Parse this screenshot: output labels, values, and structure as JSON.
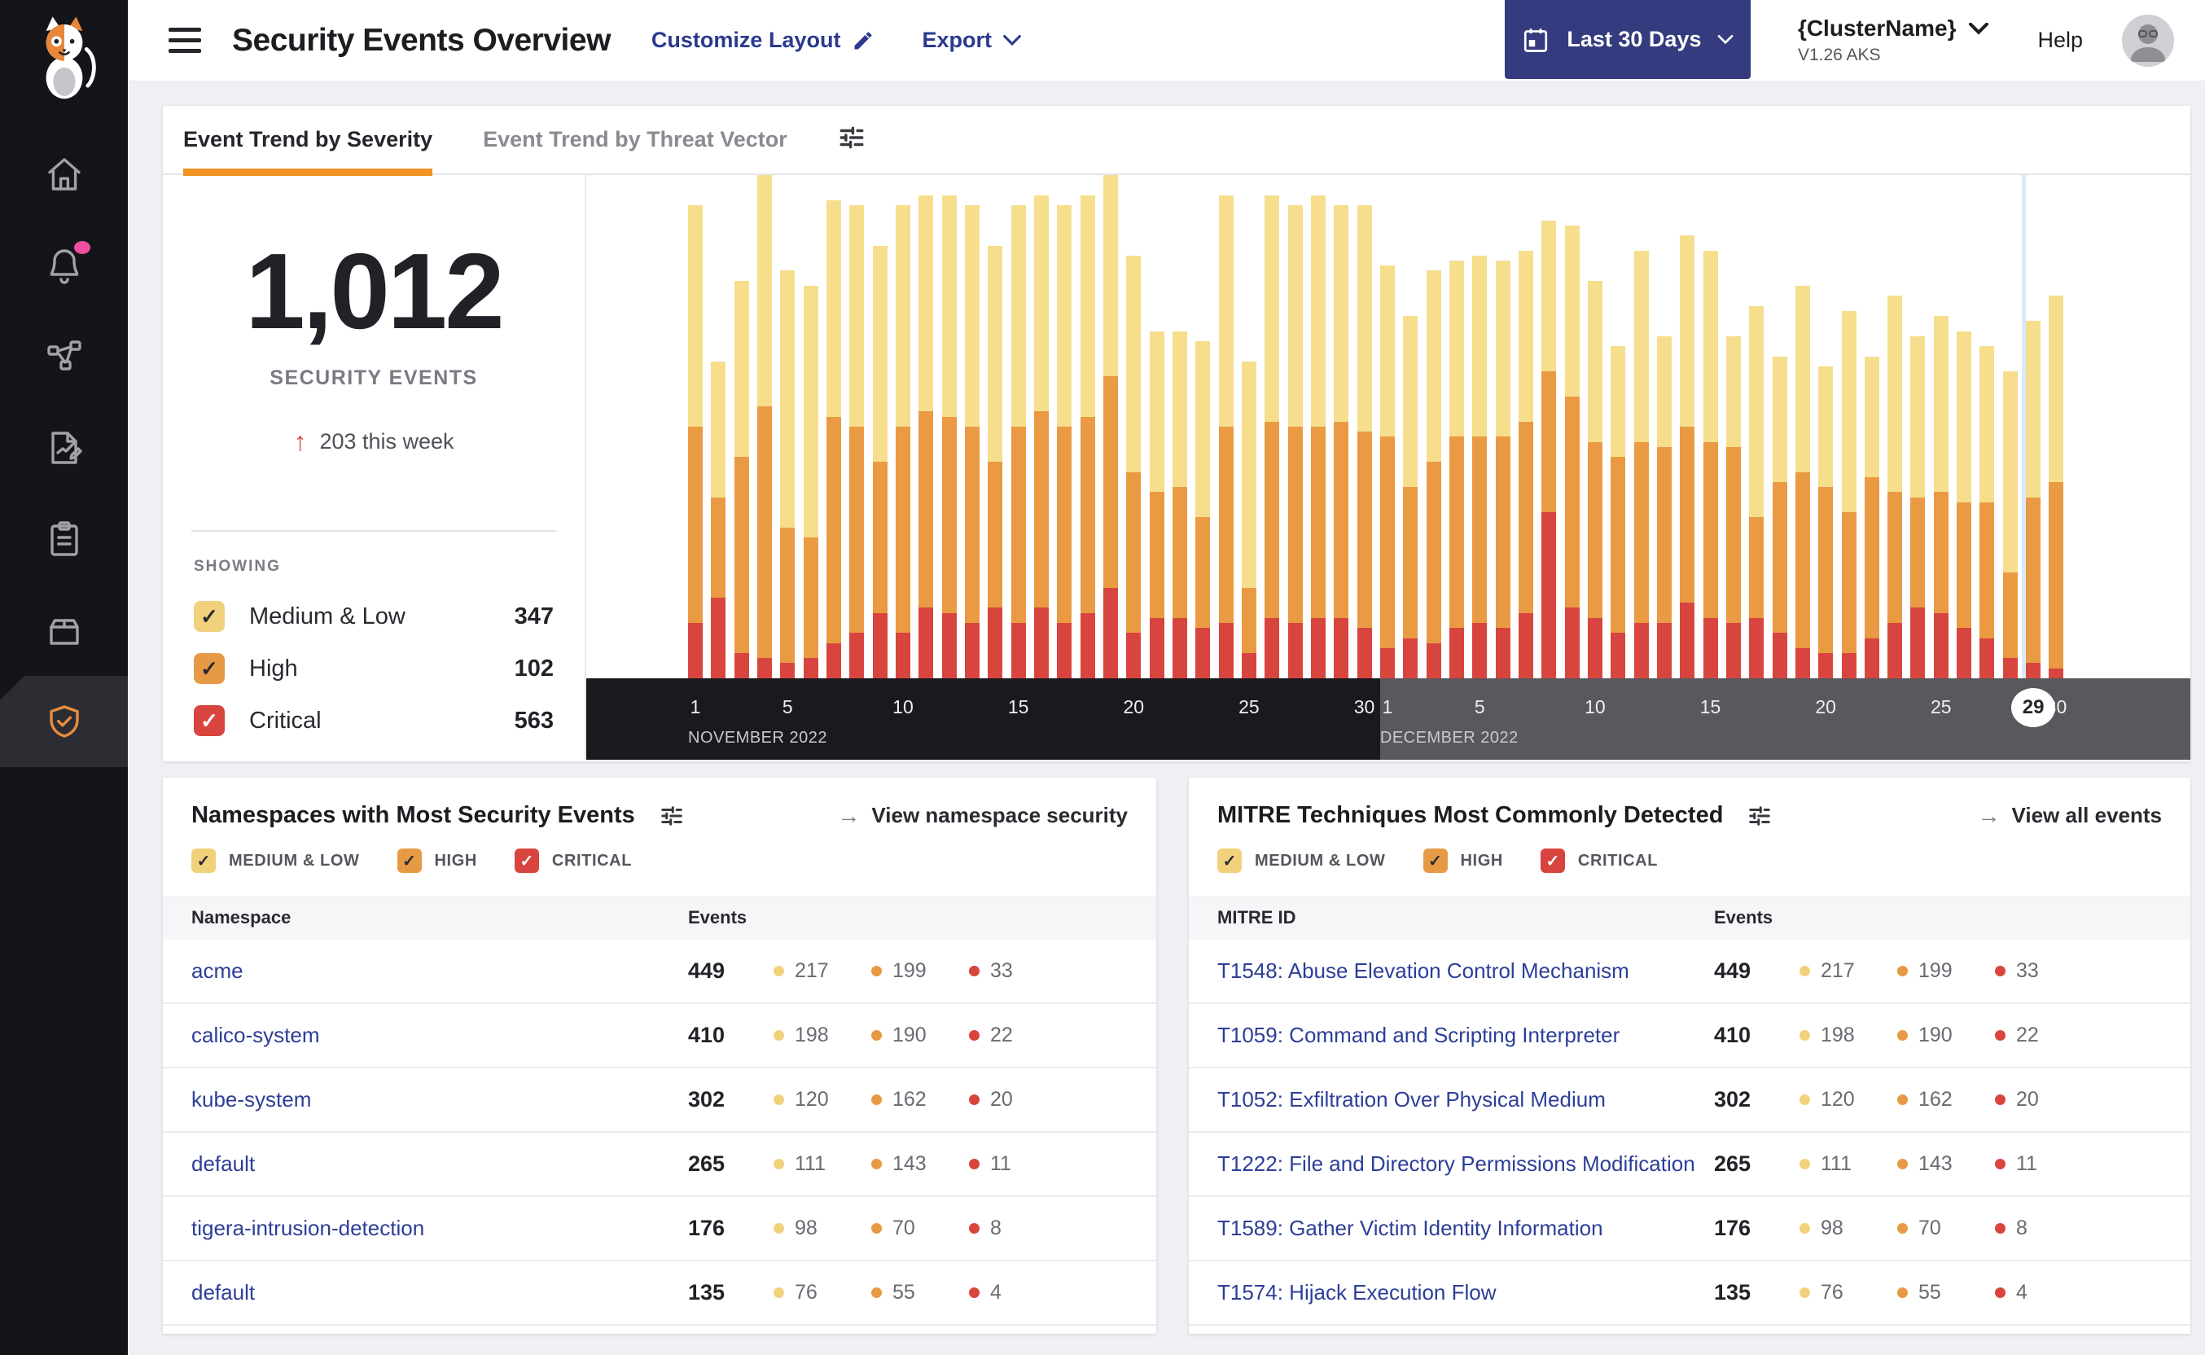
{
  "app": {
    "page_title": "Security Events Overview",
    "customize_label": "Customize Layout",
    "export_label": "Export",
    "date_range_button": "Last 30 Days",
    "cluster": {
      "name": "{ClusterName}",
      "version": "V1.26 AKS"
    },
    "help_label": "Help",
    "colors": {
      "accent_orange": "#f29423",
      "navy_button": "#343b7e",
      "link_navy": "#2b3a8f",
      "table_link_blue": "#2c3e97",
      "severity": {
        "medium_low": "#f2d17c",
        "high": "#e79a45",
        "critical": "#d8453e"
      },
      "bar": {
        "medium_low": "#f6de8d",
        "high": "#ea9a43",
        "critical": "#d8453e"
      }
    }
  },
  "sidebar": {
    "items": [
      {
        "name": "home",
        "active": false
      },
      {
        "name": "alerts",
        "active": false,
        "badge": true
      },
      {
        "name": "service-graph",
        "active": false
      },
      {
        "name": "reports",
        "active": false
      },
      {
        "name": "compliance",
        "active": false
      },
      {
        "name": "inventory",
        "active": false
      },
      {
        "name": "threat-defense",
        "active": true
      }
    ]
  },
  "tabs": [
    {
      "label": "Event Trend by Severity",
      "active": true
    },
    {
      "label": "Event Trend by Threat Vector",
      "active": false
    }
  ],
  "summary": {
    "total": "1,012",
    "caption": "SECURITY EVENTS",
    "trend_arrow": "↑",
    "trend_text": "203 this week",
    "showing_label": "SHOWING",
    "filters": [
      {
        "label": "Medium & Low",
        "count": "347",
        "severity": "medium_low",
        "checked": true
      },
      {
        "label": "High",
        "count": "102",
        "severity": "high",
        "checked": true
      },
      {
        "label": "Critical",
        "count": "563",
        "severity": "critical",
        "checked": true
      }
    ]
  },
  "chart_data": {
    "type": "bar",
    "stacked": true,
    "title": "Event Trend by Severity",
    "start_date": "Nov 1, 2022",
    "end_date": "Dec 30, 2022",
    "num_days": 60,
    "y_axis_visible": false,
    "unit": "percent of plot height (no y-axis labels shown)",
    "x_axis": {
      "months": [
        {
          "label": "NOVEMBER 2022",
          "ticks": [
            1,
            5,
            10,
            15,
            20,
            25,
            30
          ]
        },
        {
          "label": "DECEMBER 2022",
          "ticks": [
            1,
            5,
            10,
            15,
            20,
            25,
            30
          ]
        }
      ]
    },
    "current_day_marker": {
      "month_index": 1,
      "day": 29,
      "label": "29"
    },
    "series": [
      {
        "key": "critical",
        "name": "Critical",
        "color": "#d8453e",
        "values": [
          11,
          16,
          5,
          4,
          3,
          4,
          7,
          9,
          13,
          9,
          14,
          13,
          11,
          14,
          11,
          14,
          11,
          13,
          18,
          9,
          12,
          12,
          10,
          11,
          5,
          12,
          11,
          12,
          12,
          10,
          6,
          8,
          7,
          10,
          11,
          10,
          13,
          33,
          14,
          12,
          9,
          11,
          11,
          15,
          12,
          11,
          12,
          9,
          6,
          5,
          5,
          8,
          11,
          14,
          13,
          10,
          8,
          4,
          3,
          2
        ]
      },
      {
        "key": "high",
        "name": "High",
        "color": "#ea9a43",
        "values": [
          39,
          20,
          39,
          50,
          27,
          24,
          45,
          41,
          30,
          41,
          39,
          39,
          39,
          29,
          39,
          39,
          39,
          39,
          42,
          32,
          25,
          26,
          22,
          39,
          13,
          39,
          39,
          38,
          39,
          39,
          42,
          30,
          36,
          38,
          37,
          38,
          38,
          28,
          42,
          35,
          35,
          36,
          35,
          35,
          35,
          35,
          20,
          30,
          35,
          33,
          28,
          32,
          26,
          22,
          24,
          25,
          27,
          17,
          33,
          37
        ]
      },
      {
        "key": "medium_low",
        "name": "Medium & Low",
        "color": "#f6de8d",
        "values": [
          44,
          27,
          35,
          46,
          51,
          50,
          43,
          44,
          43,
          44,
          43,
          44,
          44,
          43,
          44,
          43,
          44,
          44,
          40,
          43,
          32,
          31,
          35,
          46,
          45,
          45,
          44,
          46,
          43,
          45,
          34,
          34,
          38,
          35,
          36,
          35,
          34,
          30,
          34,
          32,
          22,
          38,
          22,
          38,
          38,
          22,
          42,
          25,
          37,
          24,
          40,
          24,
          39,
          32,
          35,
          34,
          31,
          40,
          35,
          37
        ]
      }
    ]
  },
  "cards": [
    {
      "title": "Namespaces with Most Security Events",
      "view_link": "View namespace security",
      "view_arrow": "→",
      "filters": [
        {
          "label": "MEDIUM & LOW",
          "severity": "medium_low",
          "checked": true
        },
        {
          "label": "HIGH",
          "severity": "high",
          "checked": true
        },
        {
          "label": "CRITICAL",
          "severity": "critical",
          "checked": true
        }
      ],
      "columns": [
        "Namespace",
        "Events"
      ],
      "rows": [
        {
          "name": "acme",
          "total": "449",
          "medium_low": "217",
          "high": "199",
          "critical": "33"
        },
        {
          "name": "calico-system",
          "total": "410",
          "medium_low": "198",
          "high": "190",
          "critical": "22"
        },
        {
          "name": "kube-system",
          "total": "302",
          "medium_low": "120",
          "high": "162",
          "critical": "20"
        },
        {
          "name": "default",
          "total": "265",
          "medium_low": "111",
          "high": "143",
          "critical": "11"
        },
        {
          "name": "tigera-intrusion-detection",
          "total": "176",
          "medium_low": "98",
          "high": "70",
          "critical": "8"
        },
        {
          "name": "default",
          "total": "135",
          "medium_low": "76",
          "high": "55",
          "critical": "4"
        }
      ]
    },
    {
      "title": "MITRE Techniques Most Commonly Detected",
      "view_link": "View all events",
      "view_arrow": "→",
      "filters": [
        {
          "label": "MEDIUM & LOW",
          "severity": "medium_low",
          "checked": true
        },
        {
          "label": "HIGH",
          "severity": "high",
          "checked": true
        },
        {
          "label": "CRITICAL",
          "severity": "critical",
          "checked": true
        }
      ],
      "columns": [
        "MITRE ID",
        "Events"
      ],
      "rows": [
        {
          "name": "T1548: Abuse Elevation Control Mechanism",
          "total": "449",
          "medium_low": "217",
          "high": "199",
          "critical": "33"
        },
        {
          "name": "T1059: Command and Scripting Interpreter",
          "total": "410",
          "medium_low": "198",
          "high": "190",
          "critical": "22"
        },
        {
          "name": "T1052: Exfiltration Over Physical Medium",
          "total": "302",
          "medium_low": "120",
          "high": "162",
          "critical": "20"
        },
        {
          "name": "T1222: File and Directory Permissions Modification",
          "total": "265",
          "medium_low": "111",
          "high": "143",
          "critical": "11"
        },
        {
          "name": "T1589: Gather Victim Identity Information",
          "total": "176",
          "medium_low": "98",
          "high": "70",
          "critical": "8"
        },
        {
          "name": "T1574: Hijack Execution Flow",
          "total": "135",
          "medium_low": "76",
          "high": "55",
          "critical": "4"
        }
      ]
    }
  ]
}
